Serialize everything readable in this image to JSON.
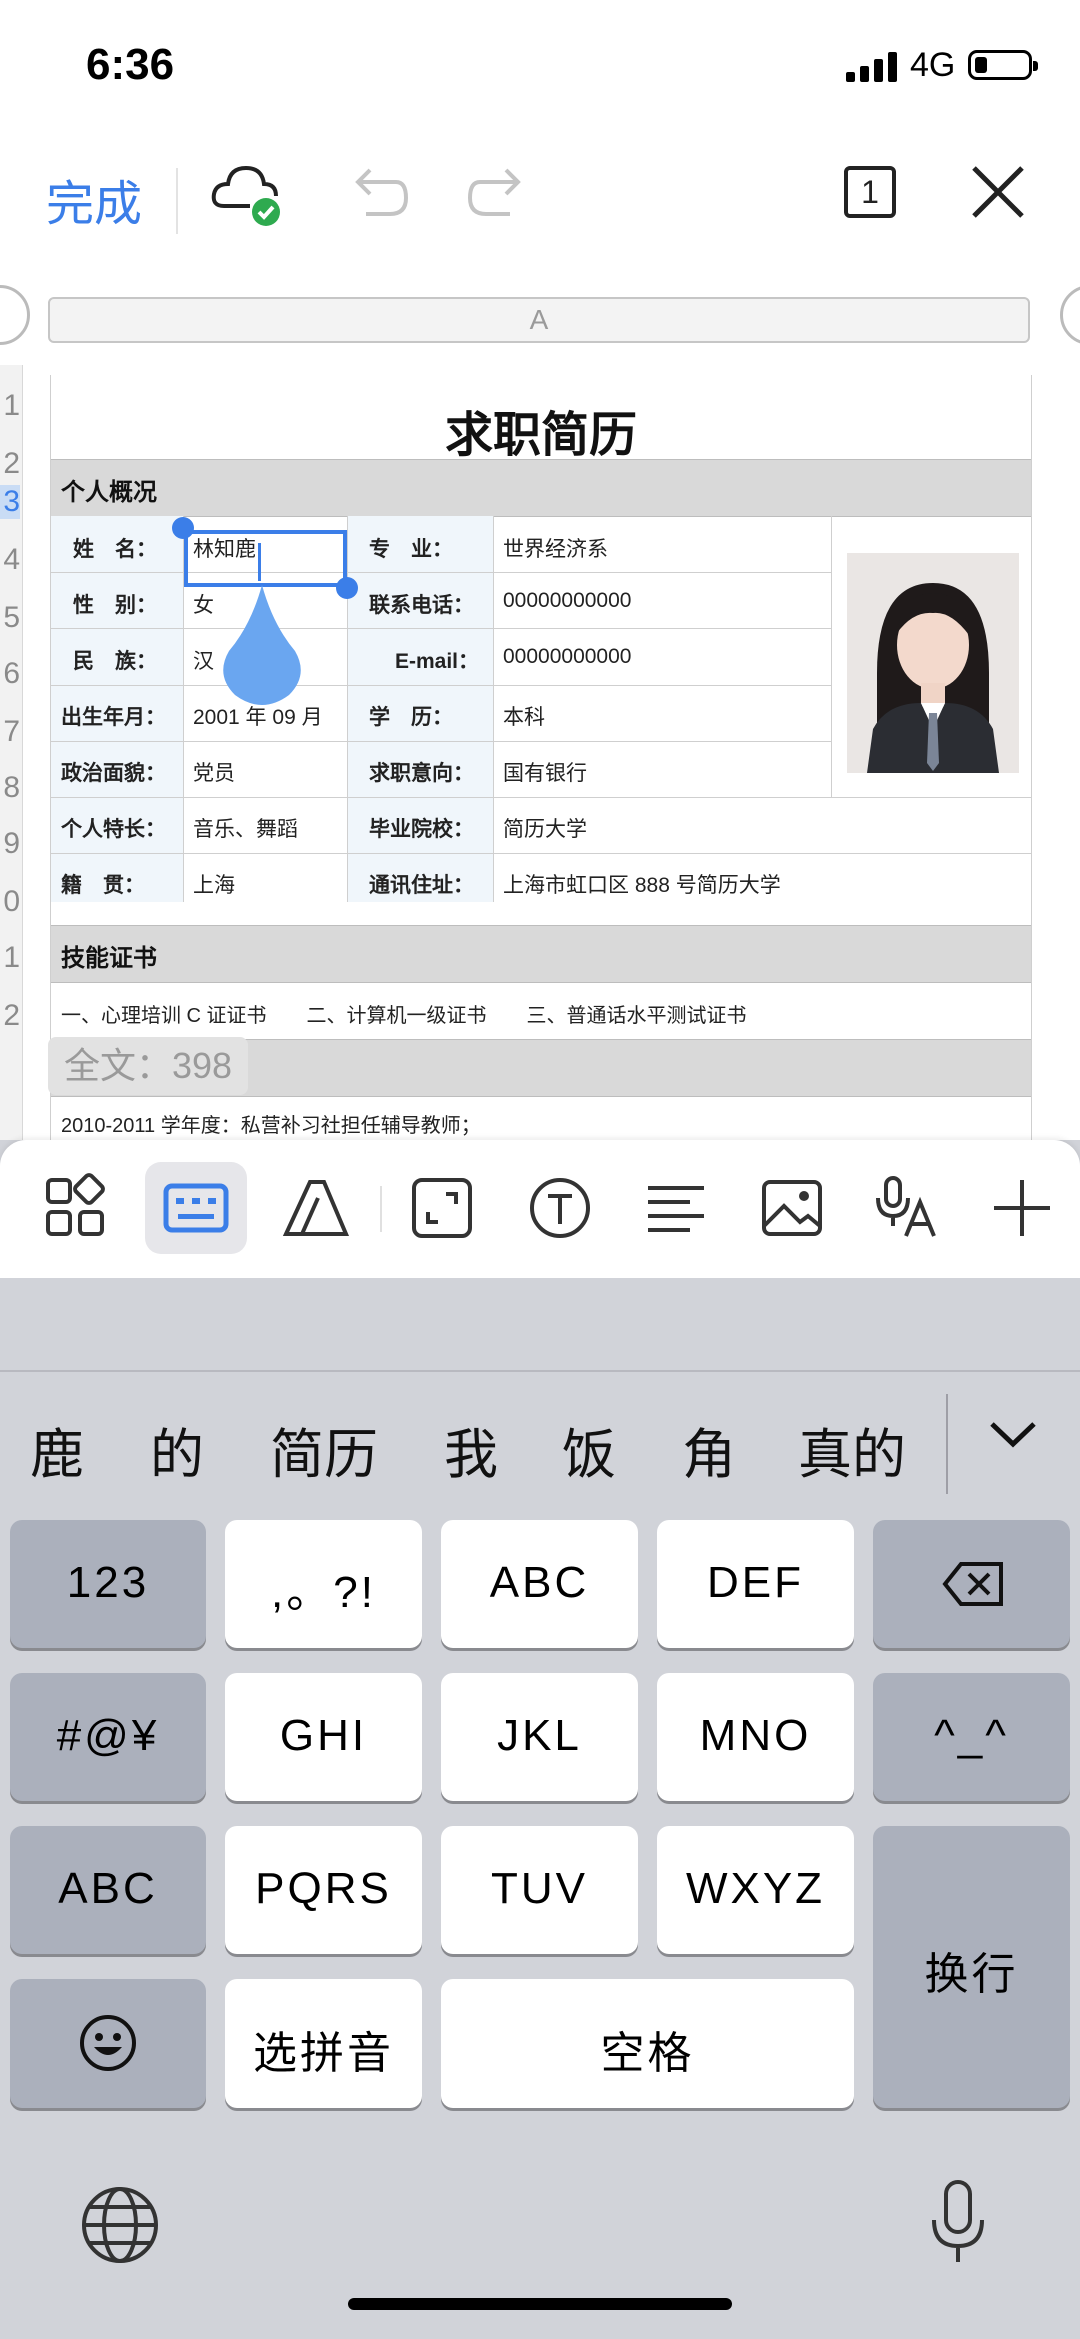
{
  "status_bar": {
    "time": "6:36",
    "network": "4G"
  },
  "toolbar": {
    "done_label": "完成",
    "page_count": "1"
  },
  "sheet": {
    "column_header": "A",
    "row_numbers": [
      "1",
      "2",
      "3",
      "4",
      "5",
      "6",
      "7",
      "8",
      "9",
      "0",
      "1",
      "2"
    ],
    "title": "求职简历",
    "section_personal": "个人概况",
    "fields": {
      "name_label": "姓　名：",
      "name_value": "林知鹿",
      "major_label": "专　业：",
      "major_value": "世界经济系",
      "gender_label": "性　别：",
      "gender_value": "女",
      "phone_label": "联系电话：",
      "phone_value": "00000000000",
      "ethnicity_label": "民　族：",
      "ethnicity_value": "汉",
      "email_label": "E-mail：",
      "email_value": "00000000000",
      "birth_label": "出生年月：",
      "birth_value": "2001 年 09 月",
      "education_label": "学　历：",
      "education_value": "本科",
      "politics_label": "政治面貌：",
      "politics_value": "党员",
      "intent_label": "求职意向：",
      "intent_value": "国有银行",
      "skills_label": "个人特长：",
      "skills_value": "音乐、舞蹈",
      "school_label": "毕业院校：",
      "school_value": "简历大学",
      "hometown_label": "籍　贯：",
      "hometown_value": "上海",
      "address_label": "通讯住址：",
      "address_value": "上海市虹口区 888 号简历大学"
    },
    "section_certs": "技能证书",
    "certs_line": "一、心理培训 C 证证书　　二、计算机一级证书　　三、普通话水平测试证书",
    "experience_line": "2010-2011 学年度：私营补习社担任辅导教师；",
    "word_count": "全文：398"
  },
  "edit_tools": [
    "grid-icon",
    "keyboard-icon",
    "text-style-icon",
    "resize-icon",
    "text-box-icon",
    "align-icon",
    "image-icon",
    "voice-text-icon",
    "plus-icon"
  ],
  "keyboard": {
    "suggestions": [
      "鹿",
      "的",
      "简历",
      "我",
      "饭",
      "角",
      "真的"
    ],
    "rows": [
      [
        "123",
        ",。?!",
        "ABC",
        "DEF"
      ],
      [
        "#@¥",
        "GHI",
        "JKL",
        "MNO",
        "^_^"
      ],
      [
        "ABC",
        "PQRS",
        "TUV",
        "WXYZ"
      ],
      [
        "选拼音",
        "空格"
      ]
    ],
    "return_label": "换行"
  },
  "colors": {
    "accent": "#3b7ee8",
    "section_bg": "#d9d9d9",
    "keyboard_bg": "#d1d3d9",
    "dark_key": "#abb0bc"
  }
}
